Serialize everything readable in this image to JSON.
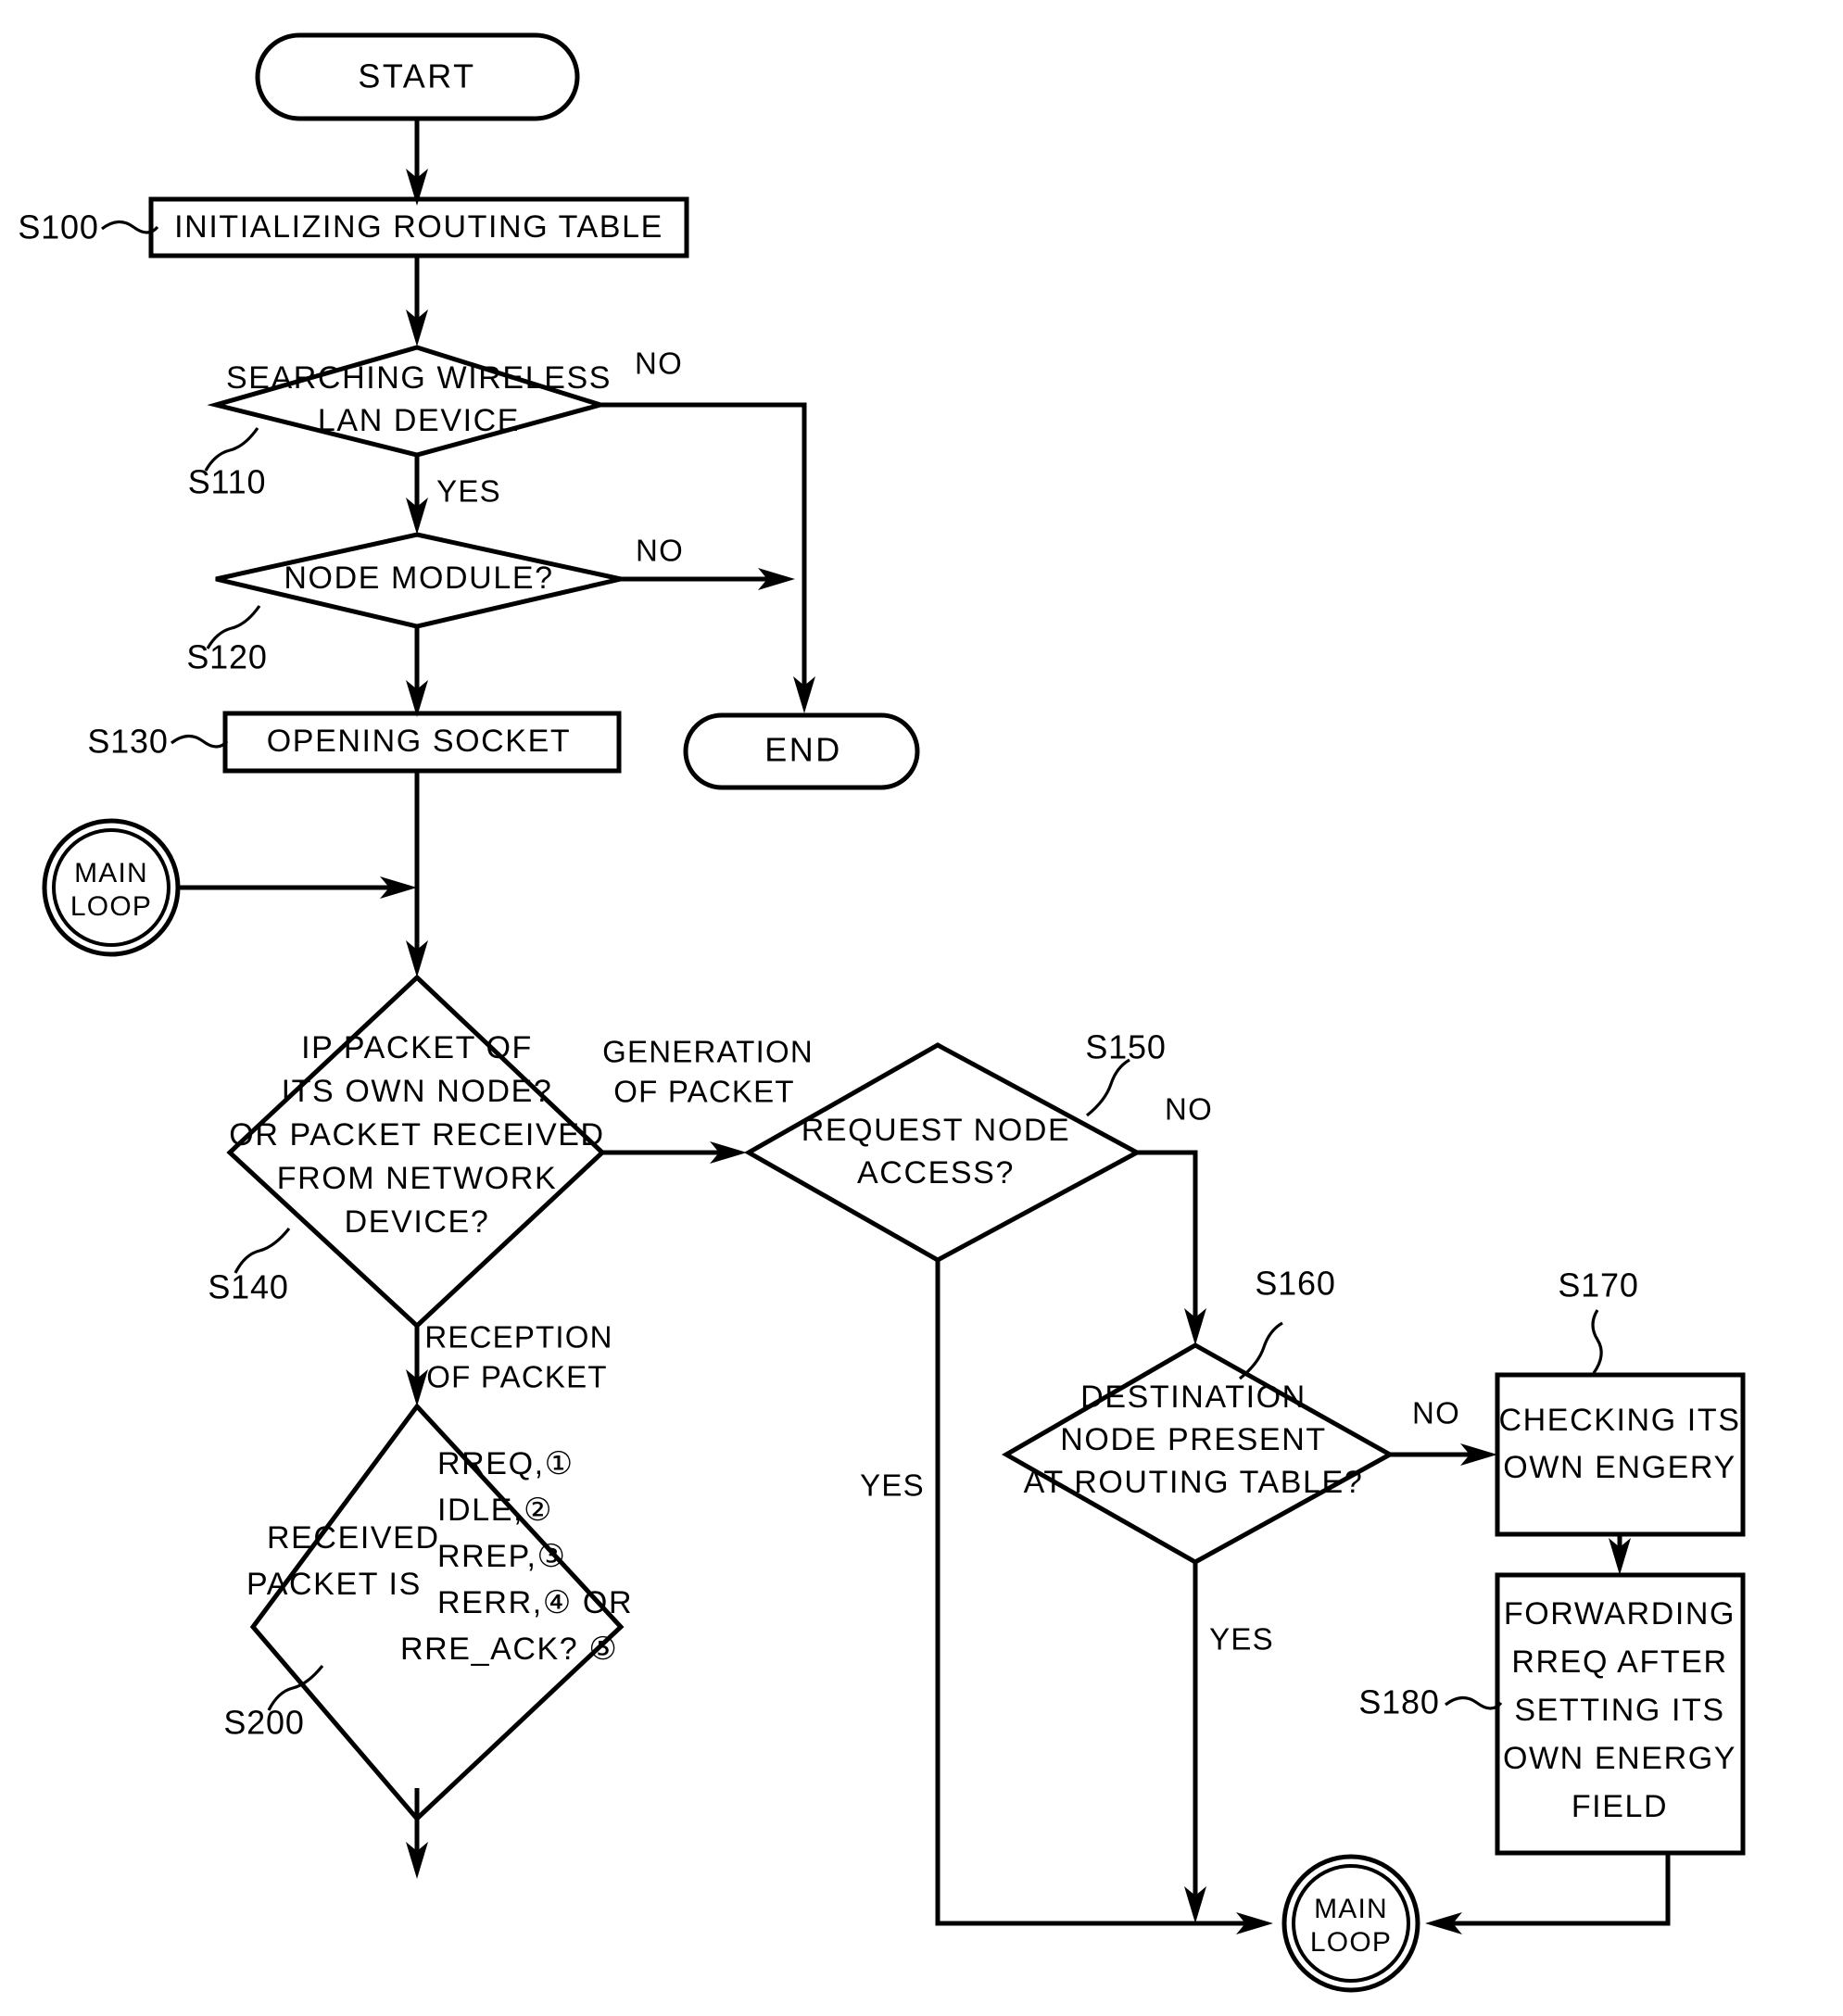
{
  "diagram": {
    "type": "flowchart",
    "title": "Wireless LAN ad-hoc routing protocol flowchart"
  },
  "nodes": {
    "start": {
      "label": "START",
      "shape": "terminator"
    },
    "s100": {
      "label": "INITIALIZING ROUTING TABLE",
      "shape": "process",
      "ref": "S100"
    },
    "s110": {
      "line1": "SEARCHING WIRELESS",
      "line2": "LAN DEVICE",
      "shape": "decision",
      "ref": "S110"
    },
    "s120": {
      "label": "NODE MODULE?",
      "shape": "decision",
      "ref": "S120"
    },
    "s130": {
      "label": "OPENING SOCKET",
      "shape": "process",
      "ref": "S130"
    },
    "end": {
      "label": "END",
      "shape": "terminator"
    },
    "main_loop_top": {
      "line1": "MAIN",
      "line2": "LOOP",
      "shape": "connector"
    },
    "s140": {
      "lines": [
        "IP PACKET OF",
        "ITS OWN NODE?",
        "OR PACKET RECEIVED",
        "FROM NETWORK",
        "DEVICE?"
      ],
      "shape": "decision",
      "ref": "S140"
    },
    "s150": {
      "line1": "REQUEST NODE",
      "line2": "ACCESS?",
      "shape": "decision",
      "ref": "S150"
    },
    "s160": {
      "lines": [
        "DESTINATION",
        "NODE PRESENT",
        "AT ROUTING TABLE?"
      ],
      "shape": "decision",
      "ref": "S160"
    },
    "s170": {
      "lines": [
        "CHECKING ITS",
        "OWN ENGERY"
      ],
      "shape": "process",
      "ref": "S170"
    },
    "s180": {
      "lines": [
        "FORWARDING",
        "RREQ AFTER",
        "SETTING ITS",
        "OWN ENERGY",
        "FIELD"
      ],
      "shape": "process",
      "ref": "S180"
    },
    "s200": {
      "left1": "RECEIVED",
      "left2": "PACKET IS",
      "lines": [
        "RREQ,①",
        "IDLE,②",
        "RREP,③",
        "RERR,④ OR",
        "RRE_ACK? ⑤"
      ],
      "shape": "decision",
      "ref": "S200"
    },
    "main_loop_bottom": {
      "line1": "MAIN",
      "line2": "LOOP",
      "shape": "connector"
    }
  },
  "edge_labels": {
    "s110_no": "NO",
    "s110_yes": "YES",
    "s120_no": "NO",
    "s140_generation_l1": "GENERATION",
    "s140_generation_l2": "OF PACKET",
    "s140_reception_l1": "RECEPTION",
    "s140_reception_l2": "OF PACKET",
    "s150_no": "NO",
    "s150_yes": "YES",
    "s160_no": "NO",
    "s160_yes": "YES"
  },
  "refs": {
    "s100": "S100",
    "s110": "S110",
    "s120": "S120",
    "s130": "S130",
    "s140": "S140",
    "s150": "S150",
    "s160": "S160",
    "s170": "S170",
    "s180": "S180",
    "s200": "S200"
  },
  "colors": {
    "stroke": "#000000",
    "background": "#ffffff"
  }
}
